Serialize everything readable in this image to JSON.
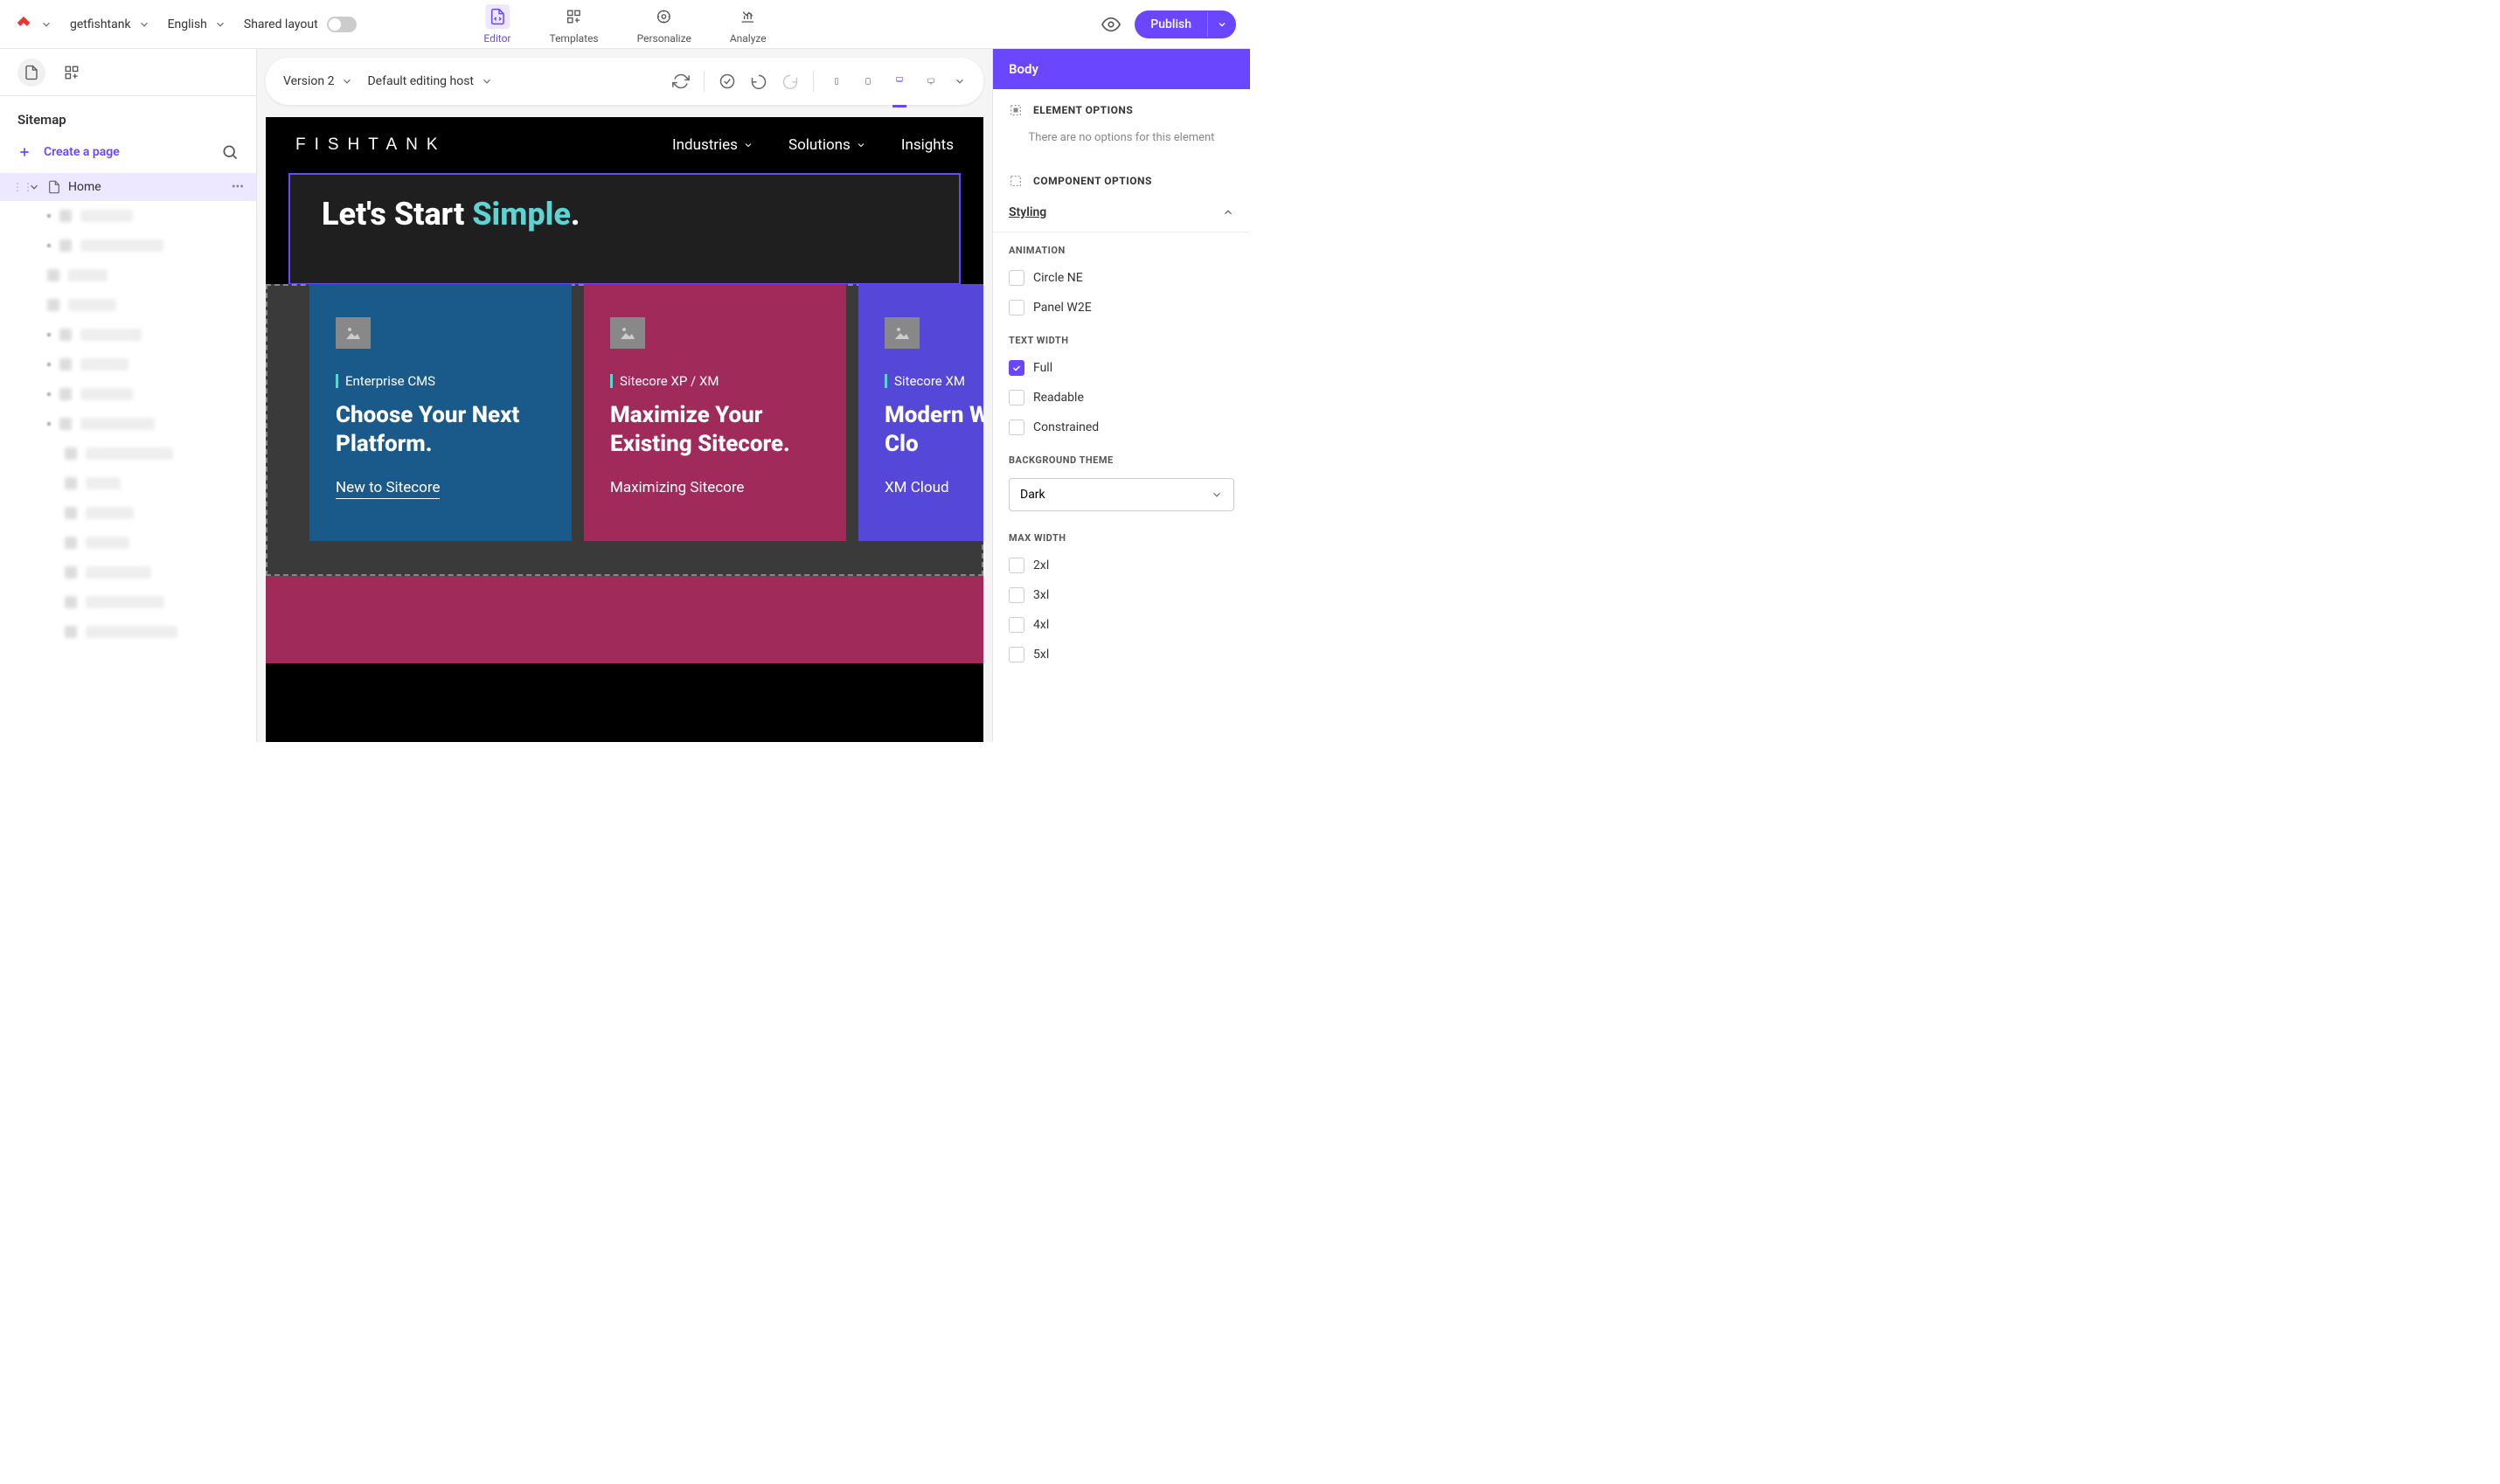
{
  "header": {
    "site": "getfishtank",
    "language": "English",
    "shared_layout": "Shared layout",
    "tabs": [
      "Editor",
      "Templates",
      "Personalize",
      "Analyze"
    ],
    "publish": "Publish"
  },
  "sidebar": {
    "title": "Sitemap",
    "create": "Create a page",
    "home": "Home"
  },
  "canvas_toolbar": {
    "version": "Version 2",
    "host": "Default editing host"
  },
  "preview": {
    "logo": "FISHTANK",
    "nav": [
      "Industries",
      "Solutions",
      "Insights"
    ],
    "hero_pre": "Let's Start ",
    "hero_accent": "Simple",
    "hero_suffix": ".",
    "cards": [
      {
        "tag": "Enterprise CMS",
        "title": "Choose Your Next Platform.",
        "link": "New to Sitecore"
      },
      {
        "tag": "Sitecore XP / XM",
        "title": "Maximize Your Existing Sitecore.",
        "link": "Maximizing Sitecore"
      },
      {
        "tag": "Sitecore XM",
        "title": "Modern With Si XM Clo",
        "link": "XM Cloud"
      }
    ]
  },
  "right": {
    "header": "Body",
    "element_options": "ELEMENT OPTIONS",
    "no_options": "There are no options for this element",
    "component_options": "COMPONENT OPTIONS",
    "styling": "Styling",
    "groups": {
      "animation": {
        "label": "ANIMATION",
        "opts": [
          "Circle NE",
          "Panel W2E"
        ]
      },
      "text_width": {
        "label": "TEXT WIDTH",
        "opts": [
          "Full",
          "Readable",
          "Constrained"
        ]
      },
      "bg_theme": {
        "label": "BACKGROUND THEME",
        "selected": "Dark"
      },
      "max_width": {
        "label": "MAX WIDTH",
        "opts": [
          "2xl",
          "3xl",
          "4xl",
          "5xl"
        ]
      }
    }
  }
}
